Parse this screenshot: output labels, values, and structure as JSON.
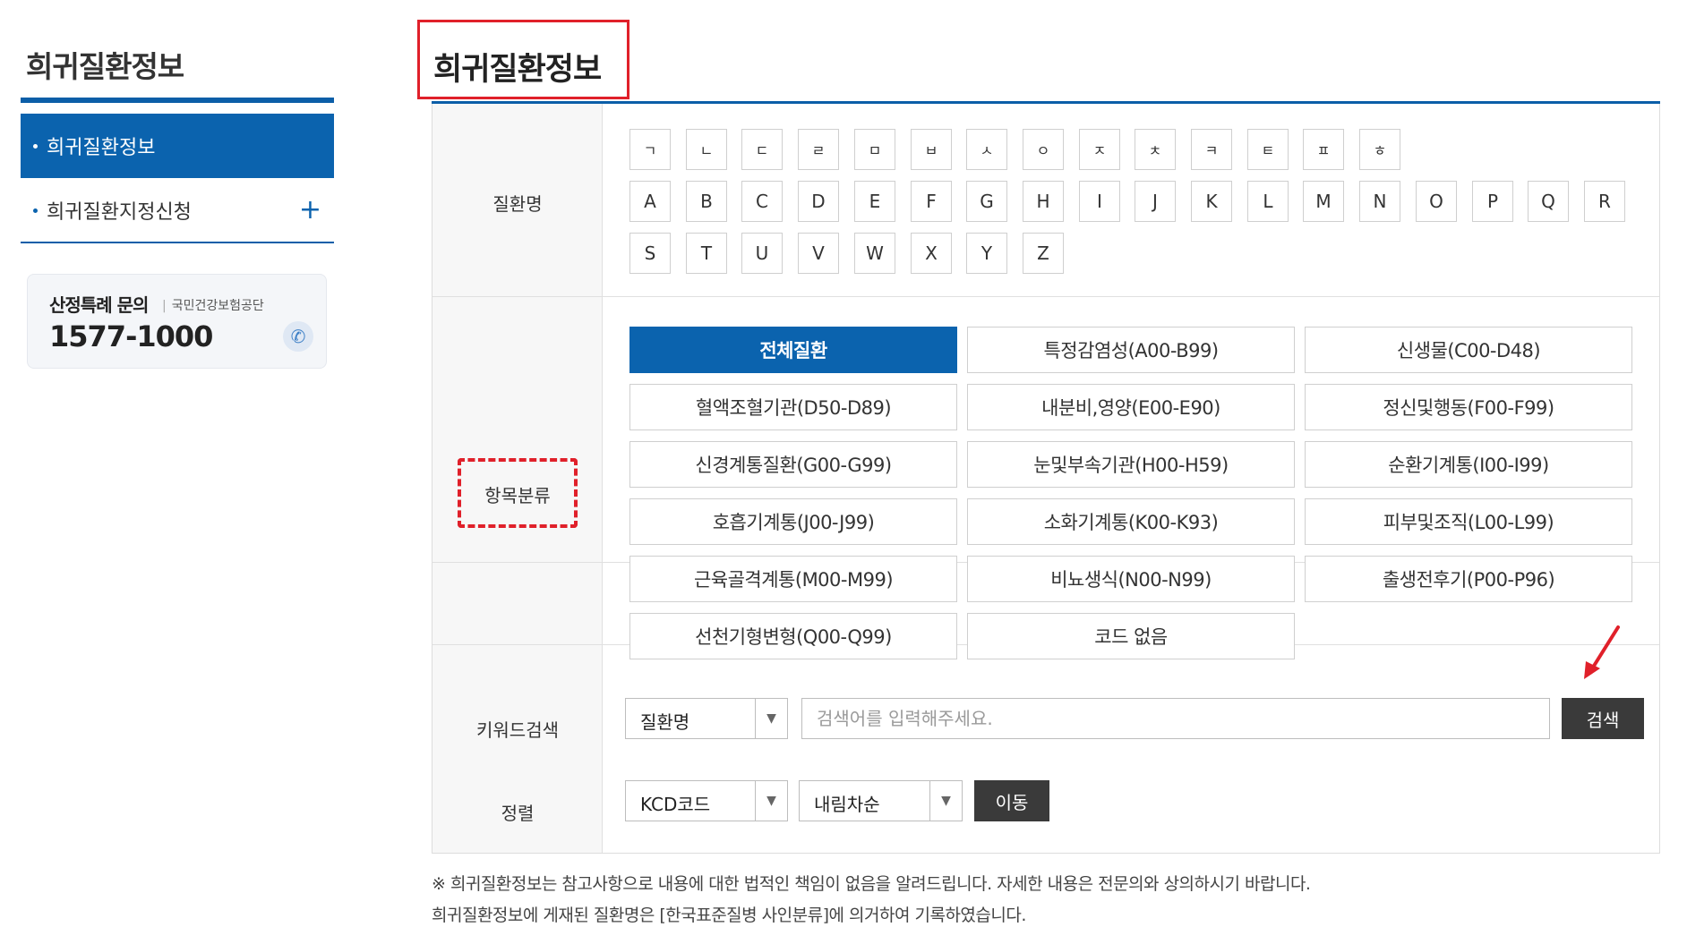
{
  "sidebar": {
    "title": "희귀질환정보",
    "items": [
      {
        "label": "희귀질환정보"
      },
      {
        "label": "희귀질환지정신청",
        "expand_symbol": "+"
      }
    ],
    "contact": {
      "title": "산정특례 문의",
      "org": "국민건강보험공단",
      "phone": "1577-1000",
      "icon": "phone-icon"
    }
  },
  "main": {
    "title": "희귀질환정보",
    "disease_name": {
      "label": "질환명",
      "korean_letters": [
        "ㄱ",
        "ㄴ",
        "ㄷ",
        "ㄹ",
        "ㅁ",
        "ㅂ",
        "ㅅ",
        "ㅇ",
        "ㅈ",
        "ㅊ",
        "ㅋ",
        "ㅌ",
        "ㅍ",
        "ㅎ"
      ],
      "alphabet_row1": [
        "A",
        "B",
        "C",
        "D",
        "E",
        "F",
        "G",
        "H",
        "I",
        "J",
        "K",
        "L",
        "M",
        "N",
        "O",
        "P",
        "Q",
        "R"
      ],
      "alphabet_row2": [
        "S",
        "T",
        "U",
        "V",
        "W",
        "X",
        "Y",
        "Z"
      ]
    },
    "category": {
      "label": "항목분류",
      "items": [
        {
          "label": "전체질환",
          "active": true
        },
        {
          "label": "특정감염성(A00-B99)"
        },
        {
          "label": "신생물(C00-D48)"
        },
        {
          "label": "혈액조혈기관(D50-D89)"
        },
        {
          "label": "내분비,영양(E00-E90)"
        },
        {
          "label": "정신및행동(F00-F99)"
        },
        {
          "label": "신경계통질환(G00-G99)"
        },
        {
          "label": "눈및부속기관(H00-H59)"
        },
        {
          "label": "순환기계통(I00-I99)"
        },
        {
          "label": "호흡기계통(J00-J99)"
        },
        {
          "label": "소화기계통(K00-K93)"
        },
        {
          "label": "피부및조직(L00-L99)"
        },
        {
          "label": "근육골격계통(M00-M99)"
        },
        {
          "label": "비뇨생식(N00-N99)"
        },
        {
          "label": "출생전후기(P00-P96)"
        },
        {
          "label": "선천기형변형(Q00-Q99)"
        },
        {
          "label": "코드 없음"
        }
      ]
    },
    "keyword": {
      "label": "키워드검색",
      "select_value": "질환명",
      "placeholder": "검색어를 입력해주세요.",
      "search_button": "검색"
    },
    "sort": {
      "label": "정렬",
      "field_value": "KCD코드",
      "order_value": "내림차순",
      "go_button": "이동"
    },
    "notice": [
      "※ 희귀질환정보는 참고사항으로 내용에 대한 법적인 책임이 없음을 알려드립니다. 자세한 내용은 전문의와 상의하시기 바랍니다.",
      "희귀질환정보에 게재된 질환명은 [한국표준질병 사인분류]에 의거하여 기록하였습니다."
    ]
  },
  "colors": {
    "primary": "#0b63ae",
    "annotation": "#e0202a",
    "dark_button": "#3a3a3a"
  }
}
